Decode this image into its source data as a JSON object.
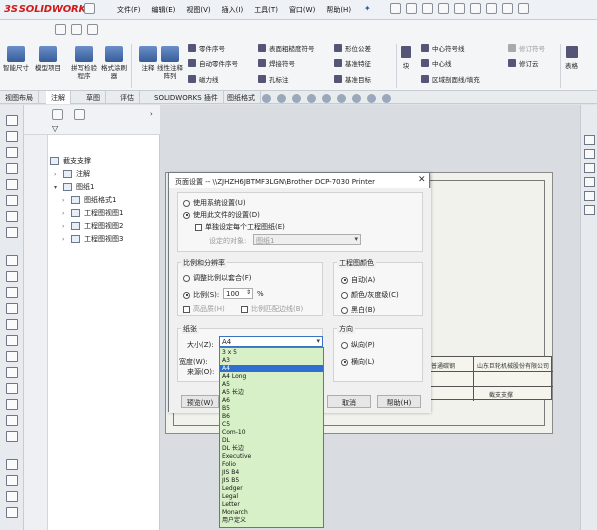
{
  "app": {
    "logo": {
      "ds": "3S",
      "name": "SOLIDWORKS"
    },
    "menu": [
      "文件(F)",
      "编辑(E)",
      "视图(V)",
      "插入(I)",
      "工具(T)",
      "窗口(W)",
      "帮助(H)"
    ],
    "pin": "✦"
  },
  "ribbon": {
    "big_buttons": [
      {
        "label": "智能尺寸"
      },
      {
        "label": "模型项目"
      },
      {
        "label": "拼写检验程序"
      },
      {
        "label": "格式涂刷器"
      },
      {
        "label": "注释"
      },
      {
        "label": "线性注释阵列"
      }
    ],
    "small_items": [
      {
        "label": "零件序号"
      },
      {
        "label": "自动零件序号"
      },
      {
        "label": "磁力线"
      },
      {
        "label": "表面粗糙度符号"
      },
      {
        "label": "焊接符号"
      },
      {
        "label": "孔标注"
      },
      {
        "label": "形位公差"
      },
      {
        "label": "基准特征"
      },
      {
        "label": "基准目标"
      },
      {
        "label": "块"
      },
      {
        "label": "中心符号线"
      },
      {
        "label": "中心线"
      },
      {
        "label": "区域剖面线/填充"
      },
      {
        "label": "修订符号"
      },
      {
        "label": "修订云"
      },
      {
        "label": "表格"
      }
    ]
  },
  "tabs": [
    "视图布局",
    "注解",
    "草图",
    "评估",
    "SOLIDWORKS 插件",
    "图纸格式"
  ],
  "active_tab": "注解",
  "tree": {
    "root": "截支支撑",
    "items": [
      "注解",
      "图纸1",
      "图纸格式1",
      "工程图视图1",
      "工程图视图2",
      "工程图视图3"
    ]
  },
  "titleblock": {
    "company": "山东巨轮机械股份有限公司",
    "material": "普通碳钢",
    "part": "截支支撑"
  },
  "dialog": {
    "title": "页面设置 -- \\\\ZJHZH6JBTMF3LGN\\Brother DCP-7030 Printer",
    "close": "✕",
    "use_system": "使用系统设置(U)",
    "use_doc": "使用此文件的设置(D)",
    "per_sheet": "单独设定每个工程图纸(E)",
    "setting_target_label": "设定的对象:",
    "setting_target_value": "图纸1",
    "scale_group": "比例和分辨率",
    "fit_scale": "调整比例以套合(F)",
    "scale": "比例(S):",
    "scale_value": "100",
    "percent": "%",
    "high_quality": "高品质(H)",
    "scale_line_weights": "比例匹配边线(B)",
    "color_group": "工程图颜色",
    "auto_color": "自动(A)",
    "gray": "颜色/灰度级(C)",
    "black_white": "黑白(B)",
    "paper_group": "纸张",
    "size_label": "大小(Z):",
    "size_value": "A4",
    "width_label": "宽度(W):",
    "source_label": "来源(O):",
    "orientation_group": "方向",
    "portrait": "纵向(P)",
    "landscape": "横向(L)",
    "preview_btn": "预览(W)",
    "cancel_btn": "取消",
    "help_btn": "帮助(H)",
    "paper_options": [
      "3 x 5",
      "A3",
      "A4",
      "A4 Long",
      "A5",
      "A5 长边",
      "A6",
      "B5",
      "B6",
      "C5",
      "Com-10",
      "DL",
      "DL 长边",
      "Executive",
      "Folio",
      "JIS B4",
      "JIS B5",
      "Ledger",
      "Legal",
      "Letter",
      "Monarch",
      "用户定义"
    ],
    "selected_option": "A4"
  }
}
